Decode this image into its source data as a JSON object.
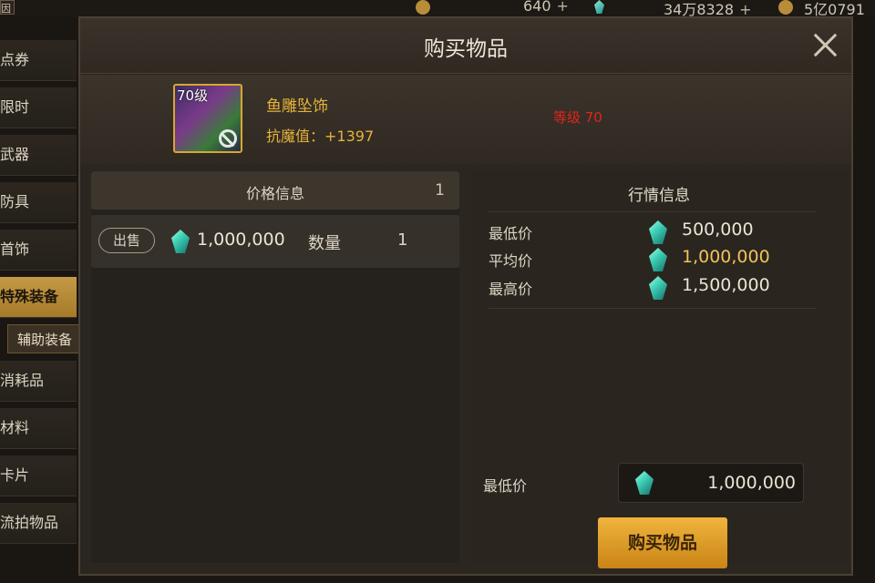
{
  "topbar": {
    "corner_label": "因",
    "currency_a_value": "640",
    "currency_b_value": "34万8328",
    "currency_c_value": "5亿0791",
    "plus": "+"
  },
  "sidebar": {
    "items": [
      {
        "label": "点券"
      },
      {
        "label": "限时"
      },
      {
        "label": "武器"
      },
      {
        "label": "防具"
      },
      {
        "label": "首饰"
      },
      {
        "label": "特殊装备"
      },
      {
        "label": "消耗品"
      },
      {
        "label": "材料"
      },
      {
        "label": "卡片"
      },
      {
        "label": "流拍物品"
      }
    ],
    "sub_item": "辅助装备"
  },
  "modal": {
    "title": "购买物品",
    "item": {
      "level_badge": "70级",
      "name": "鱼雕坠饰",
      "stat": "抗魔值：+1397",
      "requirement": "等级 70"
    },
    "price_info": {
      "title": "价格信息",
      "count": "1",
      "row": {
        "tag": "出售",
        "price": "1,000,000",
        "qty_label": "数量",
        "qty": "1"
      }
    },
    "market": {
      "title": "行情信息",
      "rows": [
        {
          "label": "最低价",
          "value": "500,000"
        },
        {
          "label": "平均价",
          "value": "1,000,000"
        },
        {
          "label": "最高价",
          "value": "1,500,000"
        }
      ],
      "min_label": "最低价",
      "min_value": "1,000,000"
    },
    "buy_button": "购买物品"
  },
  "colors": {
    "accent_gold": "#e6b23a",
    "requirement_red": "#e0251d",
    "button_gold": "#f0b43e",
    "gem_teal": "#3fd1b6"
  },
  "icons": [
    "coin-icon",
    "gem-icon",
    "close-icon",
    "no-entry-icon",
    "plus-icon"
  ]
}
